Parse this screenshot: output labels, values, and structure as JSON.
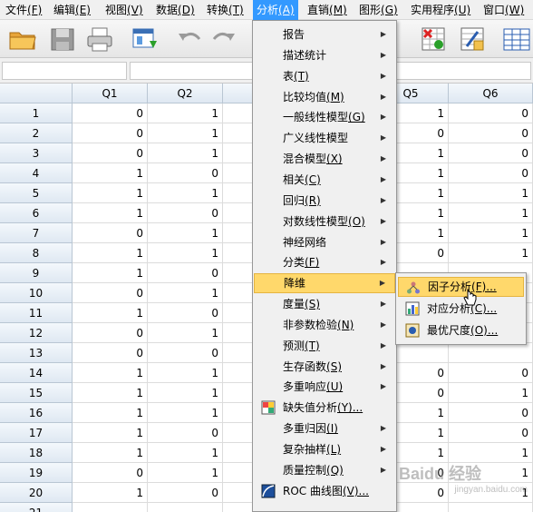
{
  "menubar": {
    "items": [
      {
        "label": "文件",
        "key": "(F)"
      },
      {
        "label": "编辑",
        "key": "(E)"
      },
      {
        "label": "视图",
        "key": "(V)"
      },
      {
        "label": "数据",
        "key": "(D)"
      },
      {
        "label": "转换",
        "key": "(T)"
      },
      {
        "label": "分析",
        "key": "(A)"
      },
      {
        "label": "直销",
        "key": "(M)"
      },
      {
        "label": "图形",
        "key": "(G)"
      },
      {
        "label": "实用程序",
        "key": "(U)"
      },
      {
        "label": "窗口",
        "key": "(W)"
      }
    ]
  },
  "toolbar": {
    "icons": [
      "open-folder-icon",
      "save-icon",
      "print-icon",
      "dialog-recall-icon",
      "undo-icon",
      "redo-icon",
      "select-cases-icon",
      "weight-cases-icon",
      "value-labels-icon"
    ]
  },
  "grid": {
    "columns": [
      "Q1",
      "Q2",
      "",
      "",
      "Q5",
      "Q6"
    ],
    "rows": [
      {
        "n": "1",
        "q1": "0",
        "q2": "1",
        "q5": "1",
        "q6": "0"
      },
      {
        "n": "2",
        "q1": "0",
        "q2": "1",
        "q5": "0",
        "q6": "0"
      },
      {
        "n": "3",
        "q1": "0",
        "q2": "1",
        "q5": "1",
        "q6": "0"
      },
      {
        "n": "4",
        "q1": "1",
        "q2": "0",
        "q5": "1",
        "q6": "0"
      },
      {
        "n": "5",
        "q1": "1",
        "q2": "1",
        "q5": "1",
        "q6": "1"
      },
      {
        "n": "6",
        "q1": "1",
        "q2": "0",
        "q5": "1",
        "q6": "1"
      },
      {
        "n": "7",
        "q1": "0",
        "q2": "1",
        "q5": "1",
        "q6": "1"
      },
      {
        "n": "8",
        "q1": "1",
        "q2": "1",
        "q5": "0",
        "q6": "1"
      },
      {
        "n": "9",
        "q1": "1",
        "q2": "0",
        "q5": "",
        "q6": ""
      },
      {
        "n": "10",
        "q1": "0",
        "q2": "1",
        "q5": "",
        "q6": ""
      },
      {
        "n": "11",
        "q1": "1",
        "q2": "0",
        "q5": "",
        "q6": ""
      },
      {
        "n": "12",
        "q1": "0",
        "q2": "1",
        "q5": "",
        "q6": ""
      },
      {
        "n": "13",
        "q1": "0",
        "q2": "0",
        "q5": "",
        "q6": ""
      },
      {
        "n": "14",
        "q1": "1",
        "q2": "1",
        "q5": "0",
        "q6": "0"
      },
      {
        "n": "15",
        "q1": "1",
        "q2": "1",
        "q5": "0",
        "q6": "1"
      },
      {
        "n": "16",
        "q1": "1",
        "q2": "1",
        "q5": "1",
        "q6": "0"
      },
      {
        "n": "17",
        "q1": "1",
        "q2": "0",
        "q5": "1",
        "q6": "0"
      },
      {
        "n": "18",
        "q1": "1",
        "q2": "1",
        "q5": "1",
        "q6": "1"
      },
      {
        "n": "19",
        "q1": "0",
        "q2": "1",
        "q5": "0",
        "q6": "1"
      },
      {
        "n": "20",
        "q1": "1",
        "q2": "0",
        "q5": "0",
        "q6": "1"
      },
      {
        "n": "21",
        "q1": "",
        "q2": "",
        "q5": "",
        "q6": ""
      }
    ]
  },
  "analyze_menu": {
    "items": [
      {
        "label": "报告",
        "key": "",
        "submenu": true
      },
      {
        "label": "描述统计",
        "key": "",
        "submenu": true
      },
      {
        "label": "表",
        "key": "(T)",
        "submenu": true
      },
      {
        "label": "比较均值",
        "key": "(M)",
        "submenu": true
      },
      {
        "label": "一般线性模型",
        "key": "(G)",
        "submenu": true
      },
      {
        "label": "广义线性模型",
        "key": "",
        "submenu": true
      },
      {
        "label": "混合模型",
        "key": "(X)",
        "submenu": true
      },
      {
        "label": "相关",
        "key": "(C)",
        "submenu": true
      },
      {
        "label": "回归",
        "key": "(R)",
        "submenu": true
      },
      {
        "label": "对数线性模型",
        "key": "(O)",
        "submenu": true
      },
      {
        "label": "神经网络",
        "key": "",
        "submenu": true
      },
      {
        "label": "分类",
        "key": "(F)",
        "submenu": true
      },
      {
        "label": "降维",
        "key": "",
        "submenu": true,
        "highlighted": true
      },
      {
        "label": "度量",
        "key": "(S)",
        "submenu": true
      },
      {
        "label": "非参数检验",
        "key": "(N)",
        "submenu": true
      },
      {
        "label": "预测",
        "key": "(T)",
        "submenu": true
      },
      {
        "label": "生存函数",
        "key": "(S)",
        "submenu": true
      },
      {
        "label": "多重响应",
        "key": "(U)",
        "submenu": true
      },
      {
        "label": "缺失值分析",
        "key": "(Y)...",
        "submenu": false,
        "icon": "missing-value-icon"
      },
      {
        "label": "多重归因",
        "key": "(I)",
        "submenu": true
      },
      {
        "label": "复杂抽样",
        "key": "(L)",
        "submenu": true
      },
      {
        "label": "质量控制",
        "key": "(Q)",
        "submenu": true
      },
      {
        "label": "ROC 曲线图",
        "key": "(V)...",
        "submenu": false,
        "icon": "roc-curve-icon"
      }
    ]
  },
  "dimension_submenu": {
    "items": [
      {
        "label": "因子分析",
        "key": "(F)...",
        "icon": "factor-analysis-icon",
        "highlighted": true
      },
      {
        "label": "对应分析",
        "key": "(C)...",
        "icon": "correspondence-analysis-icon"
      },
      {
        "label": "最优尺度",
        "key": "(O)...",
        "icon": "optimal-scaling-icon"
      }
    ]
  },
  "watermark": {
    "text": "Baidu 经验",
    "sub": "jingyan.baidu.com"
  }
}
